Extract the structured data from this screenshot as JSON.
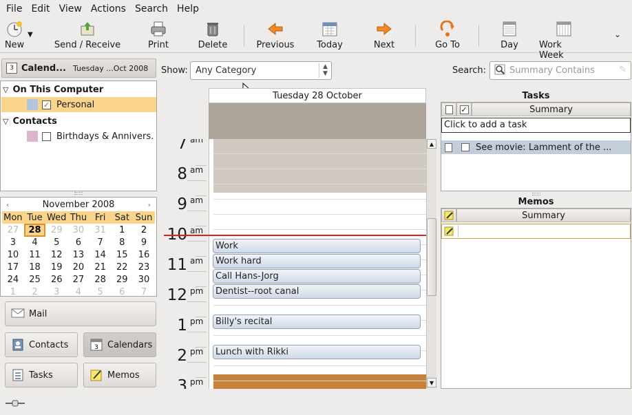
{
  "menu": [
    "File",
    "Edit",
    "View",
    "Actions",
    "Search",
    "Help"
  ],
  "toolbar": {
    "new": "New",
    "send_receive": "Send / Receive",
    "print": "Print",
    "delete": "Delete",
    "previous": "Previous",
    "today": "Today",
    "next": "Next",
    "go_to": "Go To",
    "day": "Day",
    "work_week": "Work Week"
  },
  "sidebar": {
    "header_title": "Calend...",
    "header_date": "Tuesday ...Oct 2008",
    "groups": [
      {
        "label": "On This Computer",
        "items": [
          {
            "label": "Personal",
            "color": "#b4c4dc",
            "checked": true
          }
        ]
      },
      {
        "label": "Contacts",
        "items": [
          {
            "label": "Birthdays & Annivers...",
            "color": "#dcb4cc",
            "checked": false
          }
        ]
      }
    ]
  },
  "mini_calendar": {
    "month": "November 2008",
    "prev": "‹",
    "next": "›",
    "weekdays": [
      "Mon",
      "Tue",
      "Wed",
      "Thu",
      "Fri",
      "Sat",
      "Sun"
    ],
    "weeks": [
      [
        "27",
        "28",
        "29",
        "30",
        "31",
        "1",
        "2"
      ],
      [
        "3",
        "4",
        "5",
        "6",
        "7",
        "8",
        "9"
      ],
      [
        "10",
        "11",
        "12",
        "13",
        "14",
        "15",
        "16"
      ],
      [
        "17",
        "18",
        "19",
        "20",
        "21",
        "22",
        "23"
      ],
      [
        "24",
        "25",
        "26",
        "27",
        "28",
        "29",
        "30"
      ],
      [
        "1",
        "2",
        "3",
        "4",
        "5",
        "6",
        "7"
      ]
    ],
    "today": "28"
  },
  "switcher": {
    "mail": "Mail",
    "contacts": "Contacts",
    "calendars": "Calendars",
    "tasks": "Tasks",
    "memos": "Memos"
  },
  "filter": {
    "show_label": "Show:",
    "category": "Any Category",
    "search_label": "Search:",
    "search_placeholder": "Summary Contains"
  },
  "day_view": {
    "date_header": "Tuesday 28 October",
    "hours": [
      {
        "n": "7",
        "ap": "am"
      },
      {
        "n": "8",
        "ap": "am"
      },
      {
        "n": "9",
        "ap": "am"
      },
      {
        "n": "10",
        "ap": "am"
      },
      {
        "n": "11",
        "ap": "am"
      },
      {
        "n": "12",
        "ap": "pm"
      },
      {
        "n": "1",
        "ap": "pm"
      },
      {
        "n": "2",
        "ap": "pm"
      },
      {
        "n": "3",
        "ap": "pm"
      }
    ],
    "events": [
      "Work",
      "Work hard",
      "Call Hans-Jorg",
      "Dentist--root canal",
      "Billy's recital",
      "Lunch with Rikki"
    ]
  },
  "tasks": {
    "title": "Tasks",
    "summary_header": "Summary",
    "add_placeholder": "Click to add a task",
    "items": [
      "See movie: Lamment of the ..."
    ]
  },
  "memos": {
    "title": "Memos",
    "summary_header": "Summary"
  },
  "colors": {
    "accent": "#f9d48a",
    "event_fill": "#d5dde8",
    "busy": "#aea59a",
    "orange_bar": "#c8813a",
    "now_line": "#e02020"
  }
}
